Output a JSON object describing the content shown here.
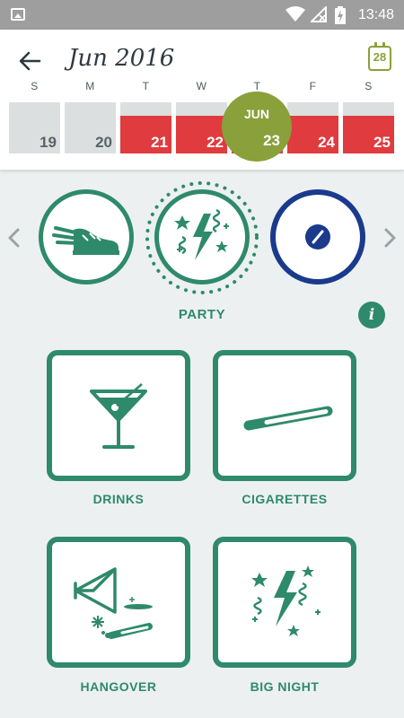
{
  "status_bar": {
    "time": "13:48",
    "icons": [
      "image-icon",
      "wifi-icon",
      "no-signal-icon",
      "battery-charging-icon"
    ]
  },
  "header": {
    "back_icon": "arrow-left-icon",
    "title": "Jun 2016",
    "calendar_day": "28",
    "weekdays": [
      "S",
      "M",
      "T",
      "W",
      "T",
      "F",
      "S"
    ],
    "days": [
      {
        "num": "19",
        "marked": false
      },
      {
        "num": "20",
        "marked": false
      },
      {
        "num": "21",
        "marked": true
      },
      {
        "num": "22",
        "marked": true
      },
      {
        "num": "23",
        "marked": true
      },
      {
        "num": "24",
        "marked": true
      },
      {
        "num": "25",
        "marked": true
      }
    ],
    "today": {
      "month": "JUN",
      "day": "23"
    }
  },
  "categories": {
    "items": [
      {
        "icon": "winged-shoe-icon"
      },
      {
        "icon": "party-streamer-icon",
        "selected": true
      },
      {
        "icon": "pill-icon"
      }
    ],
    "selected_label": "PARTY",
    "info_glyph": "i"
  },
  "tiles": [
    {
      "label": "DRINKS",
      "icon": "martini-icon"
    },
    {
      "label": "CIGARETTES",
      "icon": "cigarette-icon"
    },
    {
      "label": "HANGOVER",
      "icon": "hangover-icon"
    },
    {
      "label": "BIG NIGHT",
      "icon": "big-night-icon"
    }
  ],
  "colors": {
    "brand_green": "#2e8a6a",
    "today_green": "#8aa03a",
    "marked_red": "#e03b3e",
    "pill_blue": "#1a3a8c"
  }
}
